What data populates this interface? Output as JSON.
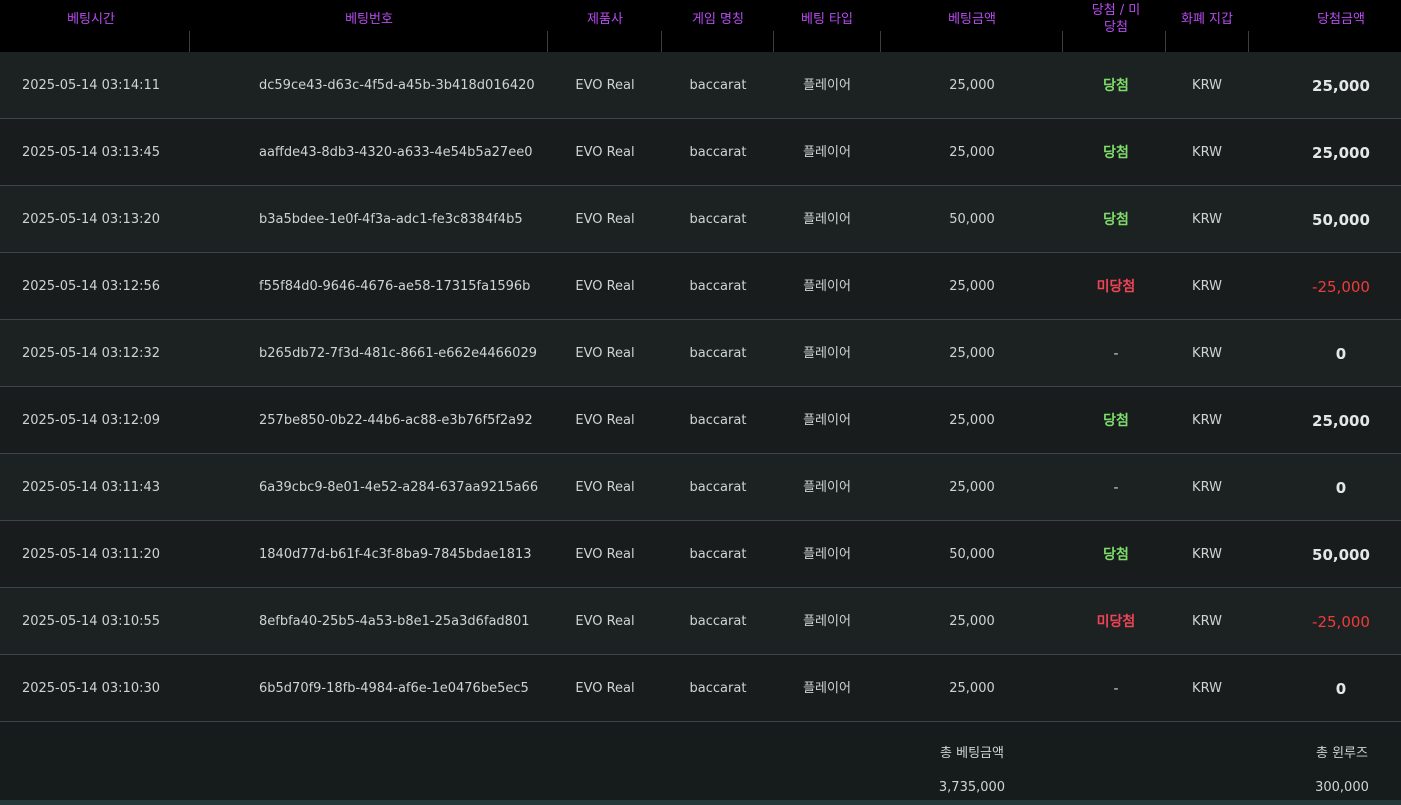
{
  "table": {
    "headers": [
      {
        "key": "time",
        "label": "베팅시간"
      },
      {
        "key": "id",
        "label": "베팅번호"
      },
      {
        "key": "provider",
        "label": "제품사"
      },
      {
        "key": "game",
        "label": "게임 명칭"
      },
      {
        "key": "type",
        "label": "베팅 타입"
      },
      {
        "key": "bet",
        "label": "베팅금액"
      },
      {
        "key": "result",
        "label": "당첨 / 미당첨"
      },
      {
        "key": "currency",
        "label": "화폐 지갑"
      },
      {
        "key": "win",
        "label": "당첨금액"
      }
    ],
    "rows": [
      {
        "time": "2025-05-14 03:14:11",
        "id": "dc59ce43-d63c-4f5d-a45b-3b418d016420",
        "provider": "EVO Real",
        "game": "baccarat",
        "type": "플레이어",
        "bet": "25,000",
        "result": "당첨",
        "result_state": "win",
        "currency": "KRW",
        "win": "25,000",
        "win_state": "pos"
      },
      {
        "time": "2025-05-14 03:13:45",
        "id": "aaffde43-8db3-4320-a633-4e54b5a27ee0",
        "provider": "EVO Real",
        "game": "baccarat",
        "type": "플레이어",
        "bet": "25,000",
        "result": "당첨",
        "result_state": "win",
        "currency": "KRW",
        "win": "25,000",
        "win_state": "pos"
      },
      {
        "time": "2025-05-14 03:13:20",
        "id": "b3a5bdee-1e0f-4f3a-adc1-fe3c8384f4b5",
        "provider": "EVO Real",
        "game": "baccarat",
        "type": "플레이어",
        "bet": "50,000",
        "result": "당첨",
        "result_state": "win",
        "currency": "KRW",
        "win": "50,000",
        "win_state": "pos"
      },
      {
        "time": "2025-05-14 03:12:56",
        "id": "f55f84d0-9646-4676-ae58-17315fa1596b",
        "provider": "EVO Real",
        "game": "baccarat",
        "type": "플레이어",
        "bet": "25,000",
        "result": "미당첨",
        "result_state": "lose",
        "currency": "KRW",
        "win": "-25,000",
        "win_state": "neg"
      },
      {
        "time": "2025-05-14 03:12:32",
        "id": "b265db72-7f3d-481c-8661-e662e4466029",
        "provider": "EVO Real",
        "game": "baccarat",
        "type": "플레이어",
        "bet": "25,000",
        "result": "-",
        "result_state": "none",
        "currency": "KRW",
        "win": "0",
        "win_state": "pos"
      },
      {
        "time": "2025-05-14 03:12:09",
        "id": "257be850-0b22-44b6-ac88-e3b76f5f2a92",
        "provider": "EVO Real",
        "game": "baccarat",
        "type": "플레이어",
        "bet": "25,000",
        "result": "당첨",
        "result_state": "win",
        "currency": "KRW",
        "win": "25,000",
        "win_state": "pos"
      },
      {
        "time": "2025-05-14 03:11:43",
        "id": "6a39cbc9-8e01-4e52-a284-637aa9215a66",
        "provider": "EVO Real",
        "game": "baccarat",
        "type": "플레이어",
        "bet": "25,000",
        "result": "-",
        "result_state": "none",
        "currency": "KRW",
        "win": "0",
        "win_state": "pos"
      },
      {
        "time": "2025-05-14 03:11:20",
        "id": "1840d77d-b61f-4c3f-8ba9-7845bdae1813",
        "provider": "EVO Real",
        "game": "baccarat",
        "type": "플레이어",
        "bet": "50,000",
        "result": "당첨",
        "result_state": "win",
        "currency": "KRW",
        "win": "50,000",
        "win_state": "pos"
      },
      {
        "time": "2025-05-14 03:10:55",
        "id": "8efbfa40-25b5-4a53-b8e1-25a3d6fad801",
        "provider": "EVO Real",
        "game": "baccarat",
        "type": "플레이어",
        "bet": "25,000",
        "result": "미당첨",
        "result_state": "lose",
        "currency": "KRW",
        "win": "-25,000",
        "win_state": "neg"
      },
      {
        "time": "2025-05-14 03:10:30",
        "id": "6b5d70f9-18fb-4984-af6e-1e0476be5ec5",
        "provider": "EVO Real",
        "game": "baccarat",
        "type": "플레이어",
        "bet": "25,000",
        "result": "-",
        "result_state": "none",
        "currency": "KRW",
        "win": "0",
        "win_state": "pos"
      }
    ]
  },
  "summary": {
    "total_bet_label": "총 베팅금액",
    "total_bet_value": "3,735,000",
    "total_rolling_label": "총 윈루즈",
    "total_rolling_value": "300,000"
  },
  "colors": {
    "header_text": "#b84cf0",
    "win": "#7edc6a",
    "lose": "#ee4455",
    "negative_amount": "#ee3b3b"
  }
}
